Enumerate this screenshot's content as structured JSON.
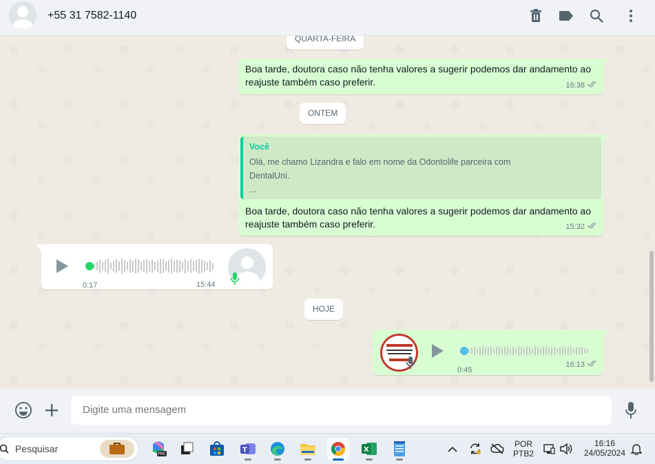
{
  "header": {
    "contact_name": "+55 31 7582-1140",
    "icons": [
      "delete-icon",
      "label-icon",
      "search-icon",
      "menu-icon"
    ]
  },
  "chat": {
    "date_chips": [
      "QUARTA-FEIRA",
      "ONTEM",
      "HOJE"
    ],
    "messages": [
      {
        "direction": "outgoing",
        "text": "Boa tarde, doutora caso não tenha valores a sugerir podemos dar andamento ao reajuste também caso preferir.",
        "time": "16:38",
        "status": "read"
      },
      {
        "direction": "outgoing",
        "quote_author": "Você",
        "quote_text": "Olá, me chamo Lizandra e falo em nome da Odontolife parceira com DentalUni.",
        "quote_more": "...",
        "text": "Boa tarde, doutora caso não tenha valores a sugerir podemos dar andamento ao reajuste também caso preferir.",
        "time": "15:32",
        "status": "read"
      },
      {
        "direction": "incoming",
        "type": "voice",
        "duration": "0:17",
        "time": "15:44"
      },
      {
        "direction": "outgoing",
        "type": "voice",
        "duration": "0:45",
        "time": "16:13",
        "status": "read"
      }
    ]
  },
  "composer": {
    "placeholder": "Digite uma mensagem",
    "icons": [
      "emoji-icon",
      "plus-icon",
      "mic-icon"
    ]
  },
  "taskbar": {
    "search_placeholder": "Pesquisar",
    "language_line1": "POR",
    "language_line2": "PTB2",
    "time": "16:16",
    "date": "24/05/2024"
  },
  "colors": {
    "chat_bg": "#efeae2",
    "outgoing_bubble": "#d9fdd3",
    "incoming_bubble": "#ffffff",
    "accent_green": "#06cf9c",
    "read_ticks": "#8696a0"
  }
}
